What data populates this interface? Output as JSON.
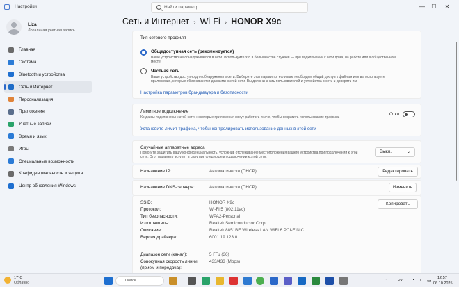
{
  "window": {
    "title": "Настройки"
  },
  "search": {
    "placeholder": "Найти параметр"
  },
  "user": {
    "name": "Liza",
    "account": "Локальная учетная запись"
  },
  "nav": [
    {
      "label": "Главная",
      "icon": "home-icon",
      "color": "#6b6b6b"
    },
    {
      "label": "Система",
      "icon": "system-icon",
      "color": "#2b7bd6"
    },
    {
      "label": "Bluetooth и устройства",
      "icon": "bluetooth-icon",
      "color": "#1e6fd0"
    },
    {
      "label": "Сеть и Интернет",
      "icon": "wifi-icon",
      "color": "#1f6cc7"
    },
    {
      "label": "Персонализация",
      "icon": "brush-icon",
      "color": "#e0843a"
    },
    {
      "label": "Приложения",
      "icon": "apps-icon",
      "color": "#5a6e8c"
    },
    {
      "label": "Учетные записи",
      "icon": "account-icon",
      "color": "#2aa36a"
    },
    {
      "label": "Время и язык",
      "icon": "clock-icon",
      "color": "#2b7bd6"
    },
    {
      "label": "Игры",
      "icon": "gamepad-icon",
      "color": "#7a7a7a"
    },
    {
      "label": "Специальные возможности",
      "icon": "accessibility-icon",
      "color": "#2b7bd6"
    },
    {
      "label": "Конфиденциальность и защита",
      "icon": "shield-icon",
      "color": "#6b6b6b"
    },
    {
      "label": "Центр обновления Windows",
      "icon": "update-icon",
      "color": "#1e6fd0"
    }
  ],
  "active_nav_index": 3,
  "breadcrumb": {
    "part1": "Сеть и Интернет",
    "part2": "Wi-Fi",
    "part3": "HONOR X9c",
    "separator": "›"
  },
  "profile": {
    "heading": "Тип сетевого профиля",
    "public_title": "Общедоступная сеть (рекомендуется)",
    "public_desc": "Ваше устройство не обнаруживается в сети. Используйте это в большинстве случаев — при подключении к сети дома, на работе или в общественном месте.",
    "private_title": "Частная сеть",
    "private_desc": "Ваше устройство доступно для обнаружения в сети. Выберите этот параметр, если вам необходим общий доступ к файлам или вы используете приложения, которые обмениваются данными в этой сети. Вы должны знать пользователей и устройства в сети и доверять им.",
    "firewall_link": "Настройка параметров брандмауэра и безопасности"
  },
  "metered": {
    "title": "Лимитное подключение",
    "desc": "Когда вы подключены к этой сети, некоторые приложения могут работать иначе, чтобы сократить использование трафика.",
    "state": "Откл.",
    "link": "Установите лимит трафика, чтобы контролировать использование данных в этой сети"
  },
  "random_hw": {
    "title": "Случайные аппаратные адреса",
    "desc": "Помогите защитить вашу конфиденциальность, усложнив отслеживание местоположения вашего устройства при подключении к этой сети. Этот параметр вступит в силу при следующем подключении к этой сети.",
    "value": "Выкл."
  },
  "ip": {
    "label": "Назначение IP:",
    "value": "Автоматически (DHCP)",
    "button": "Редактировать"
  },
  "dns": {
    "label": "Назначение DNS-сервера:",
    "value": "Автоматически (DHCP)",
    "button": "Изменить"
  },
  "props": {
    "copy_button": "Копировать",
    "rows": [
      {
        "label": "SSID:",
        "value": "HONOR X9c"
      },
      {
        "label": "Протокол:",
        "value": "Wi-Fi 5 (802.11ac)"
      },
      {
        "label": "Тип безопасности:",
        "value": "WPA2-Personal"
      },
      {
        "label": "Изготовитель:",
        "value": "Realtek Semiconductor Corp."
      },
      {
        "label": "Описание:",
        "value": "Realtek 8851BE Wireless LAN WiFi 6 PCI-E NIC"
      },
      {
        "label": "Версия драйвера:",
        "value": "6001.19.123.0"
      }
    ],
    "band_label": "Диапазон сети (канал):",
    "band_value": "5 ГГц (36)",
    "speed_label": "Совокупная скорость линии",
    "speed_label2": "(прием и передача):",
    "speed_value": "433/433 (Mbps)"
  },
  "taskbar": {
    "temp": "17°C",
    "weather": "Облачно",
    "search": "Поиск",
    "lang": "РУС",
    "time": "12:57",
    "date": "06.10.2025"
  }
}
